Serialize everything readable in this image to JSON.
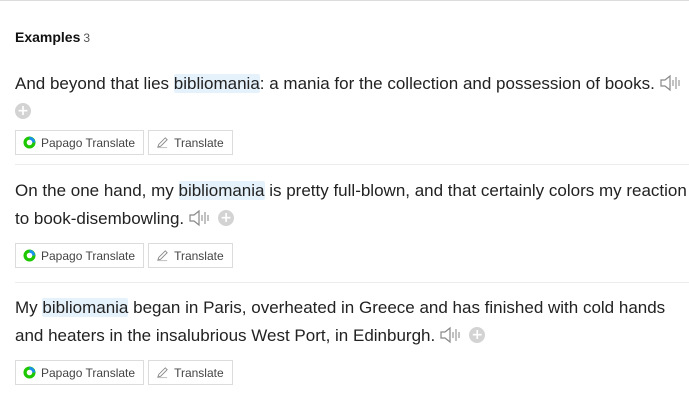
{
  "section": {
    "title": "Examples",
    "count": "3"
  },
  "examples": [
    {
      "before": "And beyond that lies ",
      "keyword": "bibliomania",
      "after": ": a mania for the collection and possession of books.",
      "papago_label": "Papago Translate",
      "translate_label": "Translate"
    },
    {
      "before": "On the one hand, my ",
      "keyword": "bibliomania",
      "after": " is pretty full-blown, and that certainly colors my reaction to book-disembowling.",
      "papago_label": "Papago Translate",
      "translate_label": "Translate"
    },
    {
      "before": "My ",
      "keyword": "bibliomania",
      "after": " began in Paris, overheated in Greece and has finished with cold hands and heaters in the insalubrious West Port, in Edinburgh.",
      "papago_label": "Papago Translate",
      "translate_label": "Translate"
    }
  ],
  "icons": {
    "speaker": "speaker-icon",
    "add": "plus-circle-icon",
    "papago": "papago-logo-icon",
    "pencil": "pencil-icon"
  },
  "colors": {
    "highlight": "#e6f2fb",
    "papago_green": "#1ec800",
    "papago_blue": "#1b8ff0"
  }
}
